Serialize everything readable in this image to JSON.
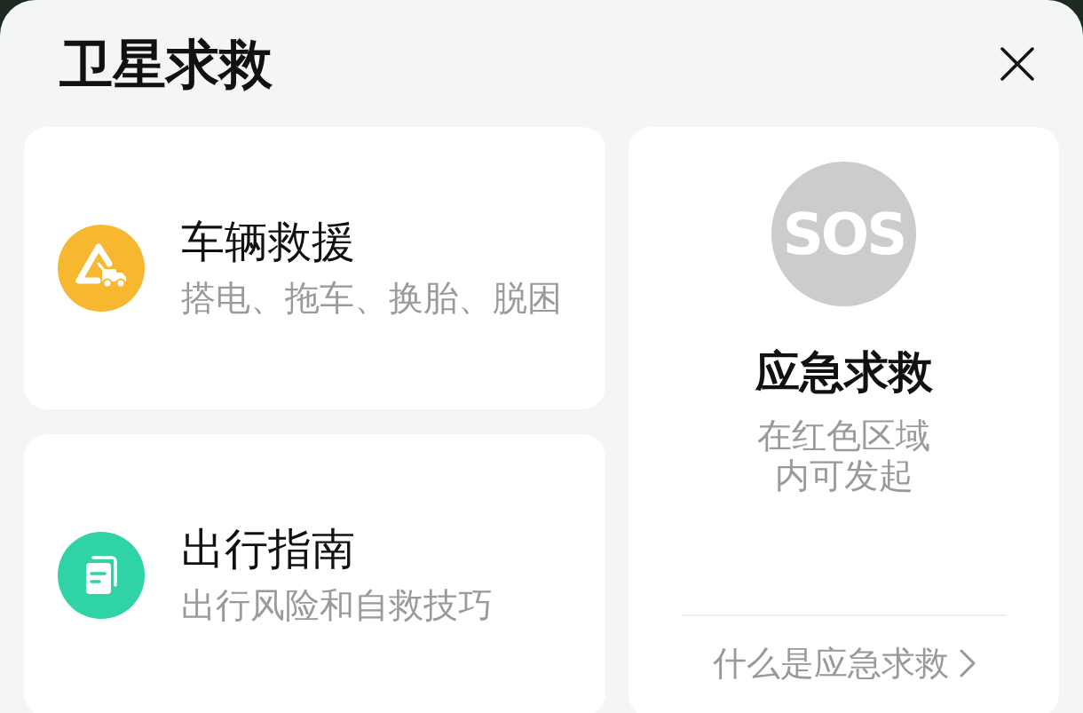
{
  "title": "卫星求救",
  "services": [
    {
      "kind": "rescue",
      "title": "车辆救援",
      "subtitle": "搭电、拖车、换胎、脱困",
      "color": "#f7b731"
    },
    {
      "kind": "guide",
      "title": "出行指南",
      "subtitle": "出行风险和自救技巧",
      "color": "#2fd3a5"
    }
  ],
  "emergency": {
    "sos": {
      "label": "SOS",
      "disabled": true
    },
    "title": "应急求救",
    "subtitle": "在红色区域内可发起",
    "link": "什么是应急求救"
  }
}
